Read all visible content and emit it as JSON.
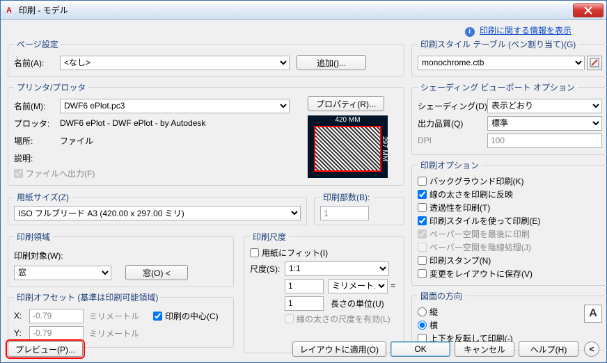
{
  "window": {
    "title": "印刷 - モデル"
  },
  "info": {
    "link": "印刷に関する情報を表示"
  },
  "page_setup": {
    "legend": "ページ設定",
    "name_label": "名前(A):",
    "name_value": "<なし>",
    "add_btn": "追加()..."
  },
  "printer": {
    "legend": "プリンタ/プロッタ",
    "name_label": "名前(M):",
    "name_value": "DWF6 ePlot.pc3",
    "properties_btn": "プロパティ(R)...",
    "plotter_label": "プロッタ:",
    "plotter_value": "DWF6 ePlot - DWF ePlot - by Autodesk",
    "where_label": "場所:",
    "where_value": "ファイル",
    "desc_label": "説明:",
    "plot_to_file": "ファイルへ出力(F)",
    "dim_w": "420 MM",
    "dim_h": "297 MM"
  },
  "paper": {
    "legend": "用紙サイズ(Z)",
    "value": "ISO フルブリード A3 (420.00 x 297.00 ミリ)"
  },
  "copies": {
    "legend": "印刷部数(B):",
    "value": "1"
  },
  "area": {
    "legend": "印刷領域",
    "what_label": "印刷対象(W):",
    "what_value": "窓",
    "window_btn": "窓(O) <"
  },
  "offset": {
    "legend": "印刷オフセット (基準は印刷可能領域)",
    "x_label": "X:",
    "x_value": "-0.79",
    "y_label": "Y:",
    "y_value": "-0.79",
    "unit": "ミリメートル",
    "center": "印刷の中心(C)"
  },
  "scale": {
    "legend": "印刷尺度",
    "fit": "用紙にフィット(I)",
    "scale_label": "尺度(S):",
    "scale_value": "1:1",
    "num": "1",
    "unit_value": "ミリメートル",
    "denom": "1",
    "denom_label": "長さの単位(U)",
    "scale_lw": "線の太さの尺度を有効(L)"
  },
  "style_table": {
    "legend": "印刷スタイル テーブル (ペン割り当て)(G)",
    "value": "monochrome.ctb"
  },
  "viewport": {
    "legend": "シェーディング ビューポート オプション",
    "shade_label": "シェーディング(D)",
    "shade_value": "表示どおり",
    "quality_label": "出力品質(Q)",
    "quality_value": "標準",
    "dpi_label": "DPI",
    "dpi_value": "100"
  },
  "options": {
    "legend": "印刷オプション",
    "background": "バックグラウンド印刷(K)",
    "lineweights": "線の太さを印刷に反映",
    "transparency": "透過性を印刷(T)",
    "plotstyles": "印刷スタイルを使って印刷(E)",
    "paperspace_last": "ペーパー空間を最後に印刷",
    "hide_paperspace": "ペーパー空間を陰線処理(J)",
    "stamp": "印刷スタンプ(N)",
    "save_layout": "変更をレイアウトに保存(V)"
  },
  "orient": {
    "legend": "図面の方向",
    "portrait": "縦",
    "landscape": "横",
    "upside": "上下を反転して印刷(-)"
  },
  "buttons": {
    "preview": "プレビュー(P)...",
    "apply_layout": "レイアウトに適用(O)",
    "ok": "OK",
    "cancel": "キャンセル",
    "help": "ヘルプ(H)"
  }
}
